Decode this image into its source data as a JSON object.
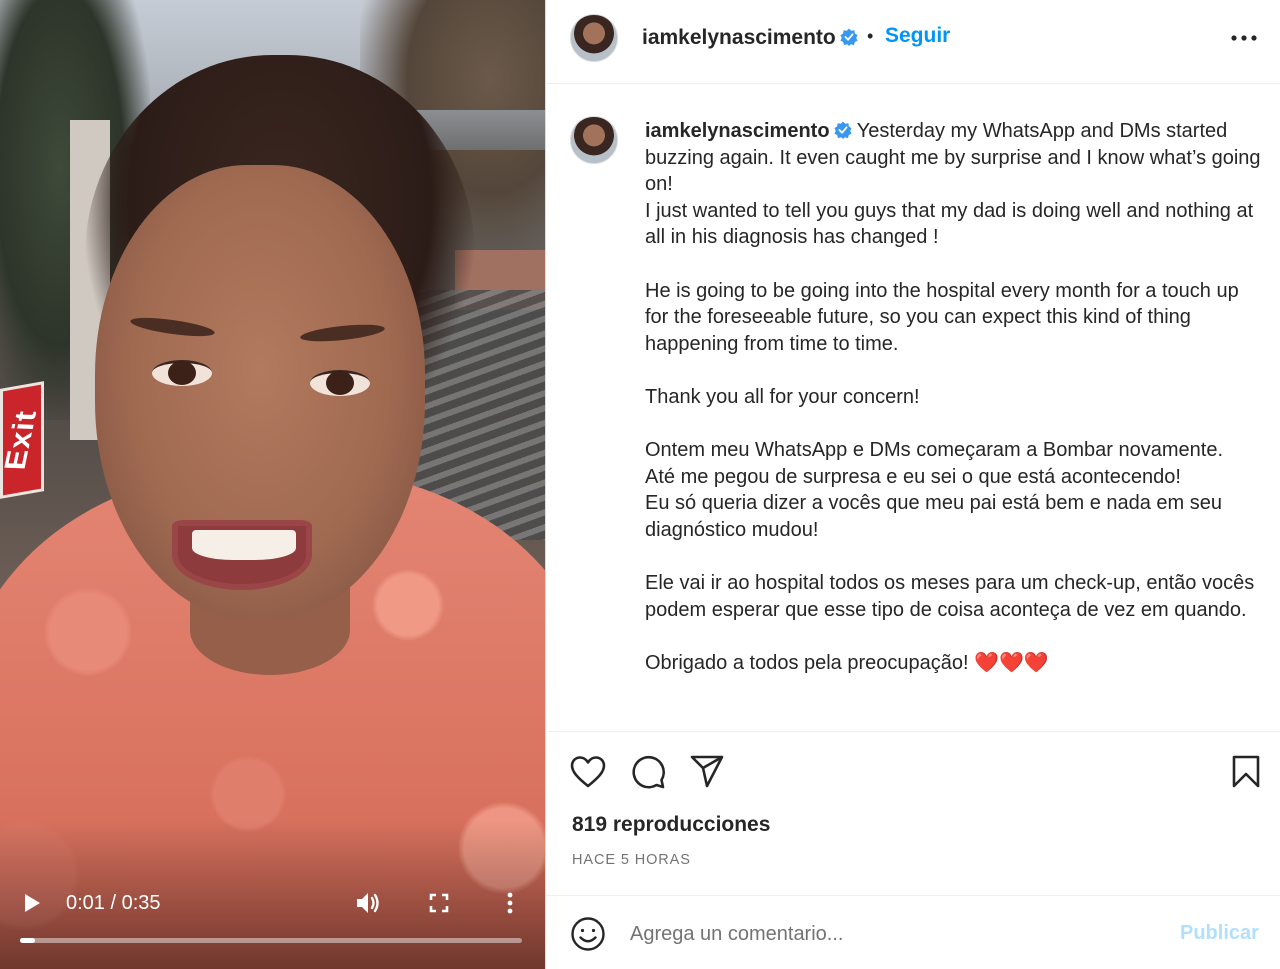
{
  "video": {
    "exit_sign_text": "Exit",
    "time_display": "0:01 / 0:35",
    "progress_fraction": 0.029,
    "icons": {
      "play": "play-icon",
      "volume": "volume-icon",
      "fullscreen": "fullscreen-icon",
      "more": "more-vertical-icon"
    }
  },
  "header": {
    "username": "iamkelynascimento",
    "separator": "•",
    "follow_label": "Seguir",
    "verified_icon": "verified-badge-icon",
    "options_icon": "more-horizontal-icon"
  },
  "caption": {
    "username": "iamkelynascimento",
    "paragraphs": [
      "Yesterday my WhatsApp and DMs started buzzing again. It even caught me by surprise and I know what’s going on!",
      "I just wanted to tell you guys that my dad is doing well and nothing at all in his diagnosis has changed !",
      "He is going to be going into the hospital every month for a touch up for the foreseeable future, so you can expect this kind of thing happening from time to time.",
      "Thank you all for your concern!",
      "Ontem meu WhatsApp e DMs começaram a Bombar novamente.",
      "Até me pegou de surpresa e eu sei o que está acontecendo!",
      "Eu só queria dizer a vocês que meu pai está bem e nada em seu diagnóstico mudou!",
      "Ele vai ir ao hospital todos os meses para um check-up, então vocês podem esperar que esse tipo de coisa aconteça de vez em quando.",
      "Obrigado a todos pela preocupação! ❤️❤️❤️"
    ]
  },
  "actions": {
    "icons": [
      "heart-icon",
      "comment-icon",
      "share-icon",
      "bookmark-icon"
    ],
    "views": "819 reproducciones",
    "posted": "HACE 5 HORAS"
  },
  "comment": {
    "placeholder": "Agrega un comentario...",
    "value": "",
    "publish_label": "Publicar",
    "emoji_icon": "emoji-icon"
  },
  "colors": {
    "link_blue": "#0095f6",
    "publish_disabled": "#b2dffc",
    "heart_red": "#e0162b",
    "verified_blue": "#3897f0"
  }
}
